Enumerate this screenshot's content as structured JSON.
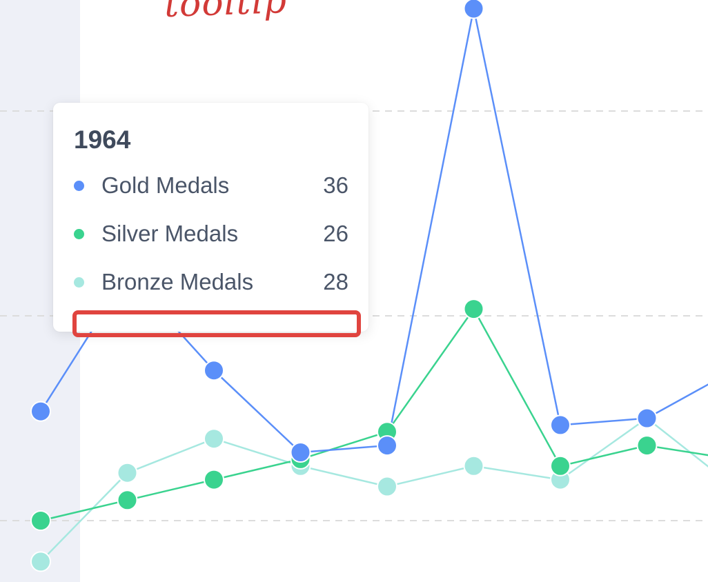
{
  "annotation": {
    "text": "tooltip",
    "color": "#d23a37"
  },
  "tooltip": {
    "title": "1964",
    "rows": [
      {
        "label": "Gold Medals",
        "value": "36",
        "color": "#5b8ff9"
      },
      {
        "label": "Silver Medals",
        "value": "26",
        "color": "#3ad38f"
      },
      {
        "label": "Bronze Medals",
        "value": "28",
        "color": "#a6e8e0"
      }
    ]
  },
  "highlight": {
    "color": "#e0443f"
  },
  "chart_data": {
    "type": "line",
    "x": [
      "",
      "1964",
      "",
      "",
      "",
      "",
      "",
      "",
      "",
      ""
    ],
    "ylim": [
      0,
      60
    ],
    "grid": true,
    "highlighted_category": "1964",
    "series": [
      {
        "name": "Gold Medals",
        "color": "#5b8ff9",
        "values": [
          16,
          36,
          22,
          10,
          11,
          75,
          14,
          15,
          22,
          16
        ]
      },
      {
        "name": "Silver Medals",
        "color": "#3ad38f",
        "values": [
          0,
          3,
          6,
          9,
          13,
          31,
          8,
          11,
          9,
          0
        ]
      },
      {
        "name": "Bronze Medals",
        "color": "#a6e8e0",
        "values": [
          -6,
          7,
          12,
          8,
          5,
          8,
          6,
          15,
          5,
          14
        ]
      }
    ]
  }
}
